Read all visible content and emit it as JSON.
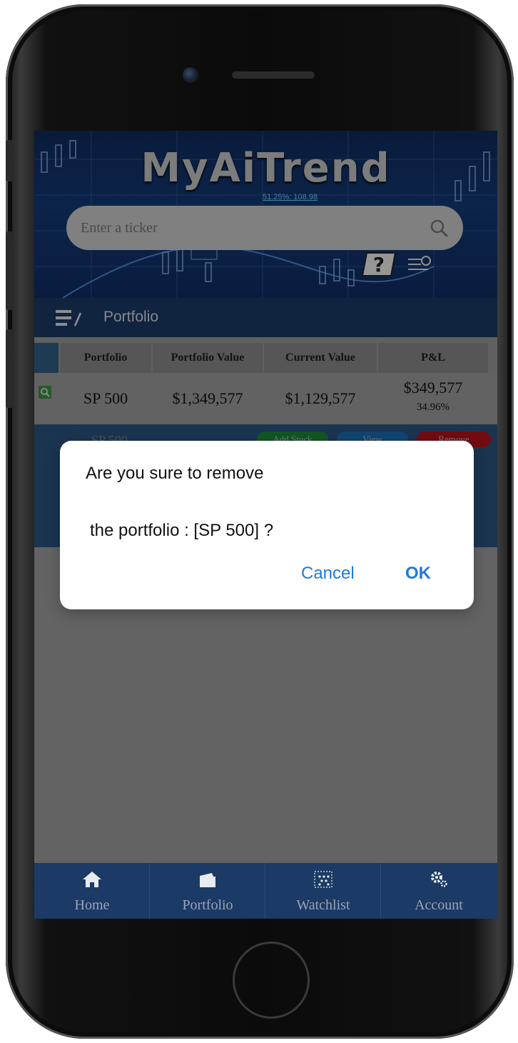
{
  "app": {
    "logo": "MyAiTrend",
    "banner_tagline": "51.25%: 108.98"
  },
  "search": {
    "placeholder": "Enter a ticker"
  },
  "nav": {
    "title": "Portfolio"
  },
  "table": {
    "headers": [
      "Portfolio",
      "Portfolio Value",
      "Current Value",
      "P&L"
    ],
    "rows": [
      {
        "name": "SP 500",
        "portfolio_value": "$1,349,577",
        "current_value": "$1,129,577",
        "pl_amount": "$349,577",
        "pl_percent": "34.96%"
      }
    ]
  },
  "actions": {
    "name": "SP 500",
    "add_stock": "Add Stock",
    "view": "View",
    "remove": "Remove"
  },
  "dialog": {
    "line1": "Are you sure to remove",
    "line2": "the portfolio : [SP 500] ?",
    "cancel": "Cancel",
    "ok": "OK"
  },
  "tabbar": {
    "items": [
      {
        "label": "Home",
        "icon": "home-icon"
      },
      {
        "label": "Portfolio",
        "icon": "portfolio-icon"
      },
      {
        "label": "Watchlist",
        "icon": "watchlist-icon"
      },
      {
        "label": "Account",
        "icon": "gears-icon"
      }
    ]
  },
  "colors": {
    "navbar": "#1b3a66",
    "dialog_button": "#1f7ae0",
    "add_stock": "#1e8a3a",
    "view": "#1e6fb5",
    "remove": "#b8141c"
  }
}
